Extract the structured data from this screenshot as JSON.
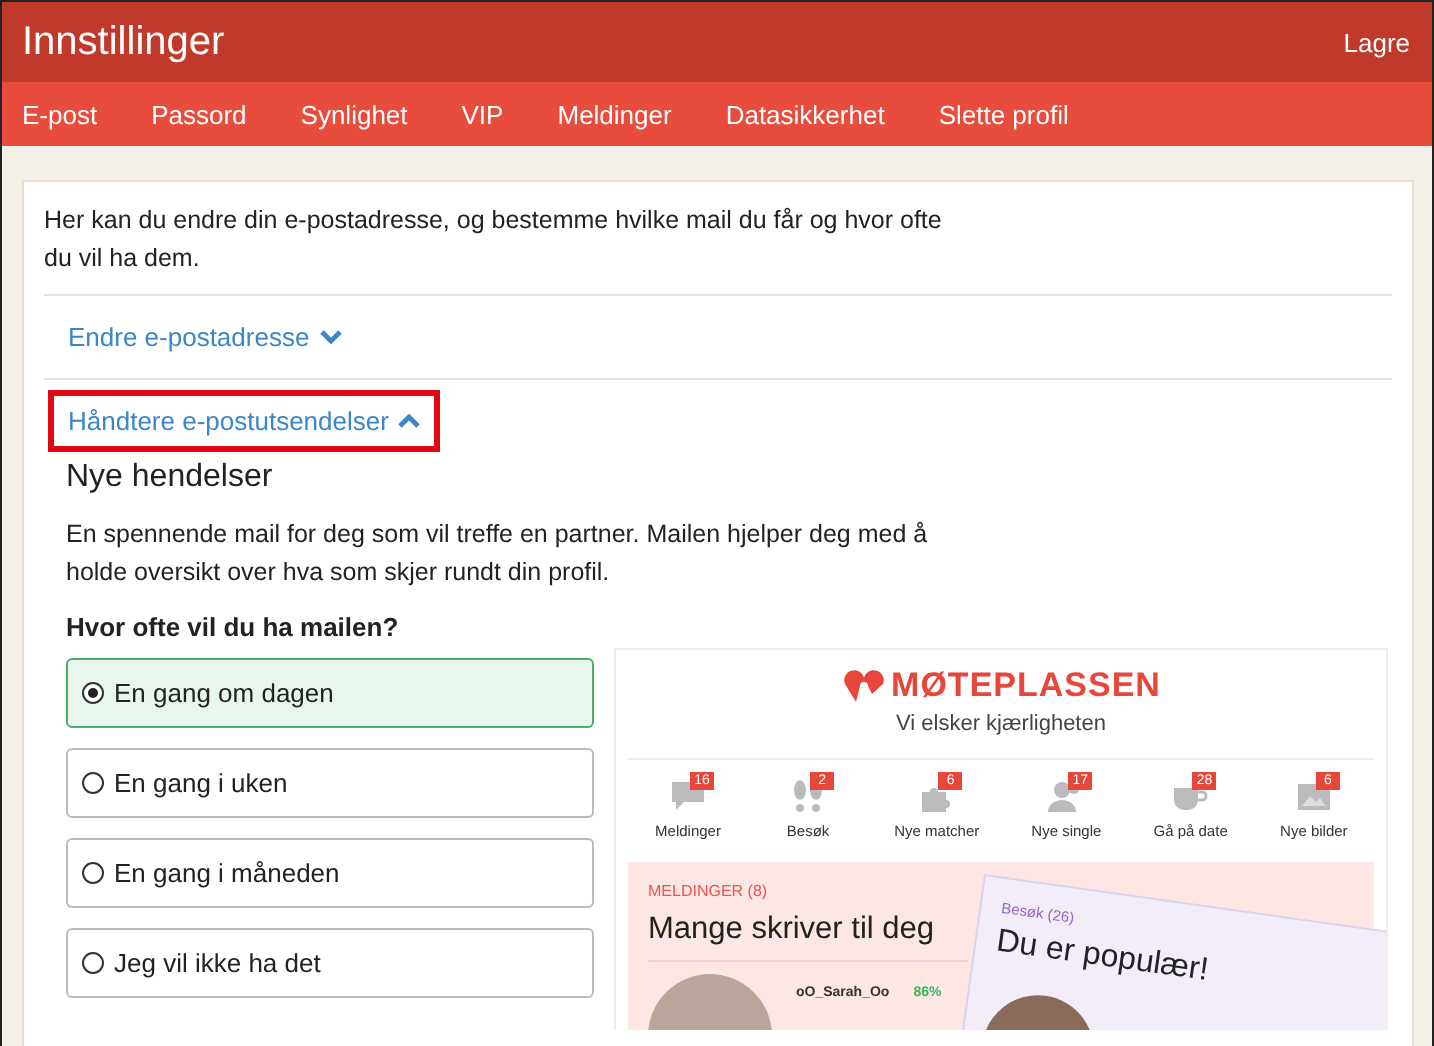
{
  "header": {
    "title": "Innstillinger",
    "save": "Lagre"
  },
  "tabs": [
    "E-post",
    "Passord",
    "Synlighet",
    "VIP",
    "Meldinger",
    "Datasikkerhet",
    "Slette profil"
  ],
  "intro": "Her kan du endre din e-postadresse, og bestemme hvilke mail du får og hvor ofte du vil ha dem.",
  "sections": [
    {
      "label": "Endre e-postadresse",
      "expanded": false,
      "highlighted": false
    },
    {
      "label": "Håndtere e-postutsendelser",
      "expanded": true,
      "highlighted": true
    }
  ],
  "newsletter": {
    "title": "Nye hendelser",
    "description": "En spennende mail for deg som vil treffe en partner. Mailen hjelper deg med å holde oversikt over hva som skjer rundt din profil.",
    "question": "Hvor ofte vil du ha mailen?",
    "options": [
      {
        "label": "En gang om dagen",
        "selected": true
      },
      {
        "label": "En gang i uken",
        "selected": false
      },
      {
        "label": "En gang i måneden",
        "selected": false
      },
      {
        "label": "Jeg vil ikke ha det",
        "selected": false
      }
    ]
  },
  "preview": {
    "brand": "MØTEPLASSEN",
    "tagline": "Vi elsker kjærligheten",
    "stats": [
      {
        "kind": "messages",
        "count": "16",
        "label": "Meldinger"
      },
      {
        "kind": "visits",
        "count": "2",
        "label": "Besøk"
      },
      {
        "kind": "matches",
        "count": "6",
        "label": "Nye matcher"
      },
      {
        "kind": "singles",
        "count": "17",
        "label": "Nye single"
      },
      {
        "kind": "date",
        "count": "28",
        "label": "Gå på date"
      },
      {
        "kind": "pictures",
        "count": "6",
        "label": "Nye bilder"
      }
    ],
    "messages": {
      "heading": "MELDINGER (8)",
      "title": "Mange skriver til deg",
      "user": "oO_Sarah_Oo",
      "match": "86%"
    },
    "visits": {
      "heading": "Besøk (26)",
      "title": "Du er populær!"
    }
  }
}
